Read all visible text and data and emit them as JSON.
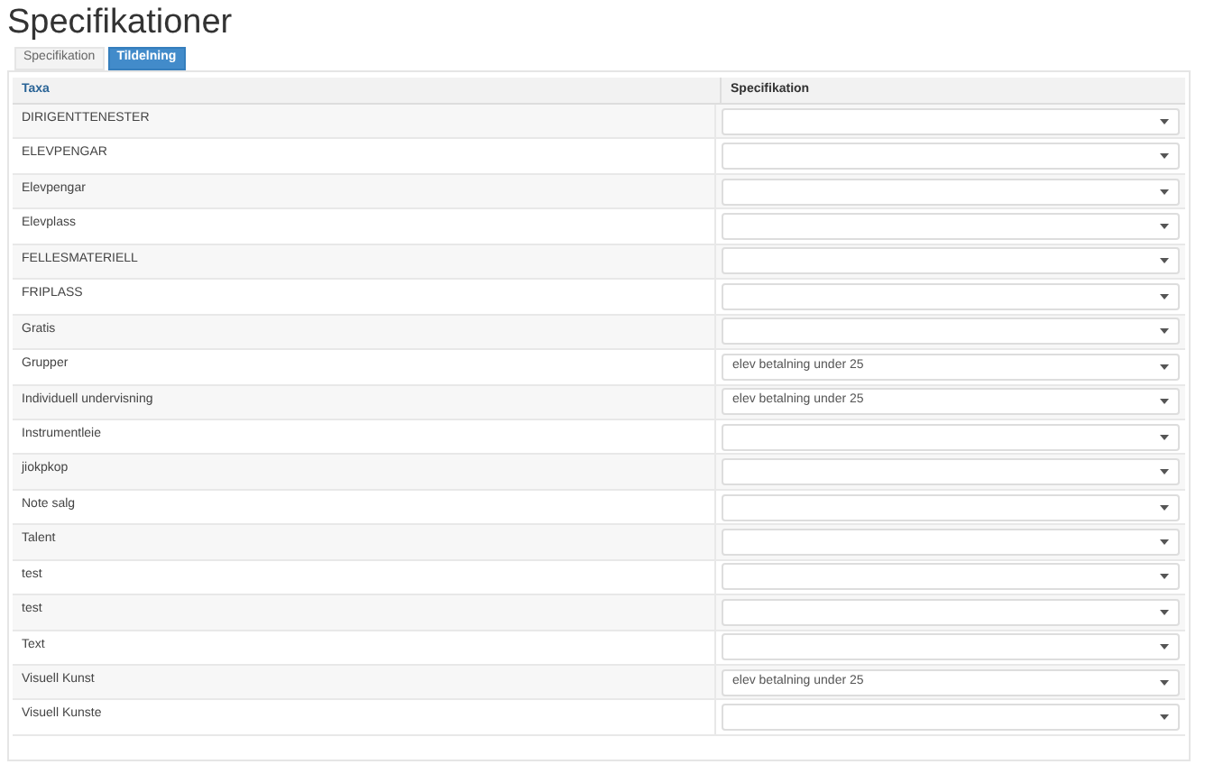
{
  "title": "Specifikationer",
  "tabs": [
    {
      "label": "Specifikation",
      "selected": false
    },
    {
      "label": "Tildelning",
      "selected": true
    }
  ],
  "table": {
    "columns": [
      "Taxa",
      "Specifikation"
    ],
    "rows": [
      {
        "taxa": "DIRIGENTTENESTER"
      },
      {
        "taxa": "ELEVPENGAR"
      },
      {
        "taxa": "Elevpengar"
      },
      {
        "taxa": "Elevplass"
      },
      {
        "taxa": "FELLESMATERIELL"
      },
      {
        "taxa": "FRIPLASS"
      },
      {
        "taxa": "Gratis"
      },
      {
        "taxa": "Grupper",
        "value": "elev betalning under 25"
      },
      {
        "taxa": "Individuell undervisning",
        "value": "elev betalning under 25"
      },
      {
        "taxa": "Instrumentleie"
      },
      {
        "taxa": "jiokpkop"
      },
      {
        "taxa": "Note salg"
      },
      {
        "taxa": "Talent"
      },
      {
        "taxa": "test"
      },
      {
        "taxa": "test"
      },
      {
        "taxa": "Text"
      },
      {
        "taxa": "Visuell Kunst",
        "value": "elev betalning under 25"
      },
      {
        "taxa": "Visuell Kunste"
      }
    ]
  }
}
